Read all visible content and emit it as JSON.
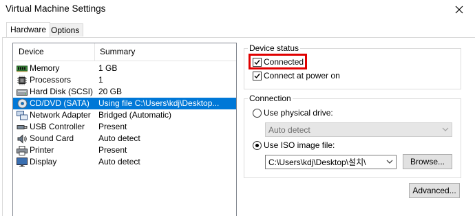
{
  "window": {
    "title": "Virtual Machine Settings"
  },
  "tabs": [
    {
      "label": "Hardware"
    },
    {
      "label": "Options"
    }
  ],
  "device_list": {
    "columns": {
      "device": "Device",
      "summary": "Summary"
    },
    "rows": [
      {
        "icon": "memory-icon",
        "name": "Memory",
        "summary": "1 GB"
      },
      {
        "icon": "processor-icon",
        "name": "Processors",
        "summary": "1"
      },
      {
        "icon": "hard-disk-icon",
        "name": "Hard Disk (SCSI)",
        "summary": "20 GB"
      },
      {
        "icon": "cd-dvd-icon",
        "name": "CD/DVD (SATA)",
        "summary": "Using file C:\\Users\\kdj\\Desktop..."
      },
      {
        "icon": "network-adapter-icon",
        "name": "Network Adapter",
        "summary": "Bridged (Automatic)"
      },
      {
        "icon": "usb-icon",
        "name": "USB Controller",
        "summary": "Present"
      },
      {
        "icon": "sound-card-icon",
        "name": "Sound Card",
        "summary": "Auto detect"
      },
      {
        "icon": "printer-icon",
        "name": "Printer",
        "summary": "Present"
      },
      {
        "icon": "display-icon",
        "name": "Display",
        "summary": "Auto detect"
      }
    ],
    "selected": "CD/DVD (SATA)"
  },
  "device_status": {
    "label": "Device status",
    "connected": {
      "label": "Connected",
      "checked": true
    },
    "connect_at_power_on": {
      "label": "Connect at power on",
      "checked": true
    }
  },
  "connection": {
    "label": "Connection",
    "physical": {
      "label": "Use physical drive:",
      "selected": false,
      "drive": "Auto detect"
    },
    "iso": {
      "label": "Use ISO image file:",
      "selected": true,
      "path": "C:\\Users\\kdj\\Desktop\\설치\\"
    },
    "browse_label": "Browse..."
  },
  "advanced_label": "Advanced...",
  "colors": {
    "selection": "#0078d7",
    "highlight_box": "#e00000"
  }
}
